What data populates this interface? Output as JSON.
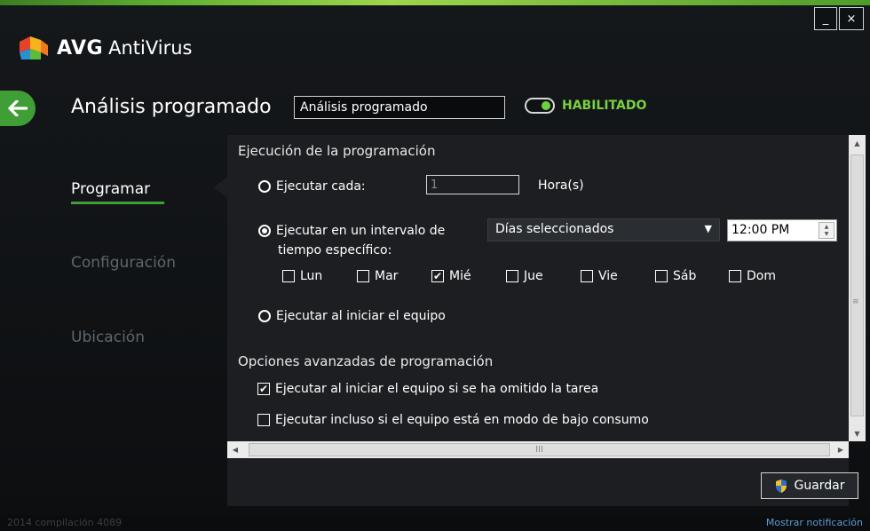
{
  "window": {
    "minimize_label": "_",
    "close_label": "×"
  },
  "app": {
    "brand": "AVG",
    "product": "AntiVirus"
  },
  "header": {
    "title": "Análisis programado",
    "name_value": "Análisis programado",
    "toggle_label": "HABILITADO",
    "toggle_on": true
  },
  "nav": {
    "items": [
      {
        "label": "Programar",
        "active": true
      },
      {
        "label": "Configuración",
        "active": false
      },
      {
        "label": "Ubicación",
        "active": false
      }
    ]
  },
  "schedule": {
    "section_title": "Ejecución de la programación",
    "run_every_label": "Ejecutar cada:",
    "run_every_value": "1",
    "run_every_unit": "Hora(s)",
    "run_interval_label_1": "Ejecutar en un intervalo de",
    "run_interval_label_2": "tiempo específico:",
    "interval_select_value": "Días seleccionados",
    "time_value": "12:00 PM",
    "days": [
      {
        "label": "Lun",
        "checked": false
      },
      {
        "label": "Mar",
        "checked": false
      },
      {
        "label": "Mié",
        "checked": true
      },
      {
        "label": "Jue",
        "checked": false
      },
      {
        "label": "Vie",
        "checked": false
      },
      {
        "label": "Sáb",
        "checked": false
      },
      {
        "label": "Dom",
        "checked": false
      }
    ],
    "run_at_startup_label": "Ejecutar al iniciar el equipo",
    "selected_option": "interval"
  },
  "advanced": {
    "section_title": "Opciones avanzadas de programación",
    "missed_label": "Ejecutar al iniciar el equipo si se ha omitido la tarea",
    "missed_checked": true,
    "low_power_label": "Ejecutar incluso si el equipo está en modo de bajo consumo",
    "low_power_checked": false
  },
  "scrollbar": {
    "thumb_grip": "III",
    "vgrip": "≡"
  },
  "actions": {
    "save_label": "Guardar"
  },
  "footer": {
    "build": "2014  compilación 4089",
    "notify_label": "Mostrar notificación"
  },
  "colors": {
    "accent_green": "#3f9f36",
    "enabled_green": "#79d043",
    "panel_bg": "#1c1e21",
    "link_blue": "#5b9bd5"
  }
}
